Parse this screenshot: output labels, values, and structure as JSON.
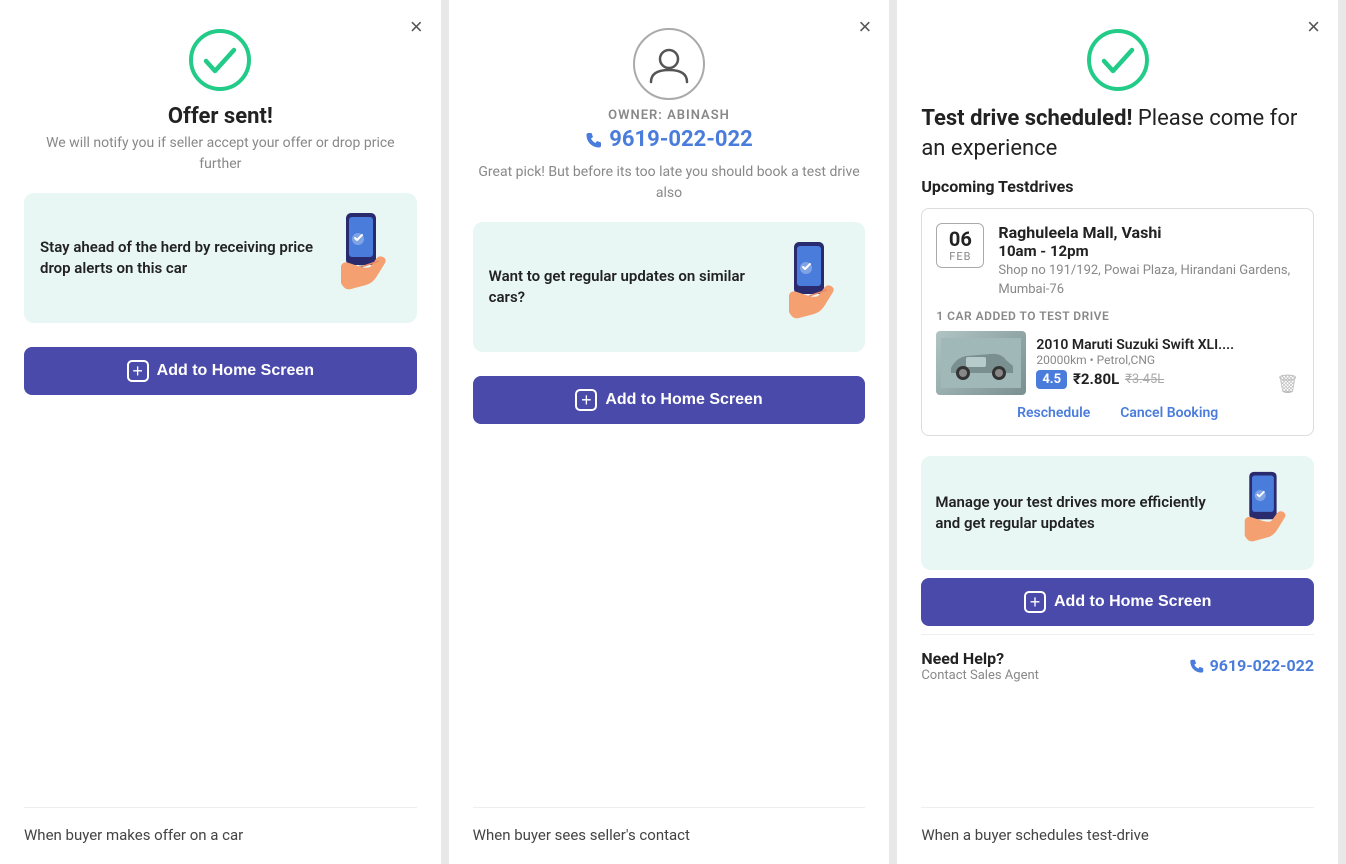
{
  "panels": [
    {
      "id": "panel1",
      "close_label": "×",
      "title": "Offer sent!",
      "subtitle": "We will notify you if seller accept your offer or drop price further",
      "cta_box_text": "Stay ahead of the herd by receiving price drop alerts on this car",
      "add_btn_label": "Add to Home Screen",
      "caption": "When buyer makes offer on a car"
    },
    {
      "id": "panel2",
      "close_label": "×",
      "owner_label": "OWNER: ABINASH",
      "owner_phone": "9619-022-022",
      "owner_desc": "Great pick! But before its too late you should book a test drive also",
      "cta_box_text": "Want to get regular updates on similar cars?",
      "add_btn_label": "Add to Home Screen",
      "caption": "When buyer sees seller's contact"
    },
    {
      "id": "panel3",
      "close_label": "×",
      "title_bold": "Test drive scheduled!",
      "title_rest": " Please come for an experience",
      "upcoming_label": "Upcoming Testdrives",
      "date_day": "06",
      "date_month": "FEB",
      "venue_name": "Raghuleela Mall, Vashi",
      "venue_time": "10am - 12pm",
      "venue_address": "Shop no 191/192, Powai Plaza, Hirandani Gardens, Mumbai-76",
      "car_added_label": "1 CAR ADDED TO TEST DRIVE",
      "car_name": "2010 Maruti Suzuki Swift XLI....",
      "car_km": "20000km • Petrol,CNG",
      "car_rating": "4.5",
      "car_price": "₹2.80L",
      "car_price_old": "₹3.45L",
      "reschedule_label": "Reschedule",
      "cancel_label": "Cancel Booking",
      "cta_box_text": "Manage your test drives more efficiently and get regular updates",
      "add_btn_label": "Add to Home Screen",
      "help_title": "Need Help?",
      "help_sub": "Contact Sales Agent",
      "help_phone": "9619-022-022",
      "caption": "When a buyer schedules test-drive"
    }
  ]
}
